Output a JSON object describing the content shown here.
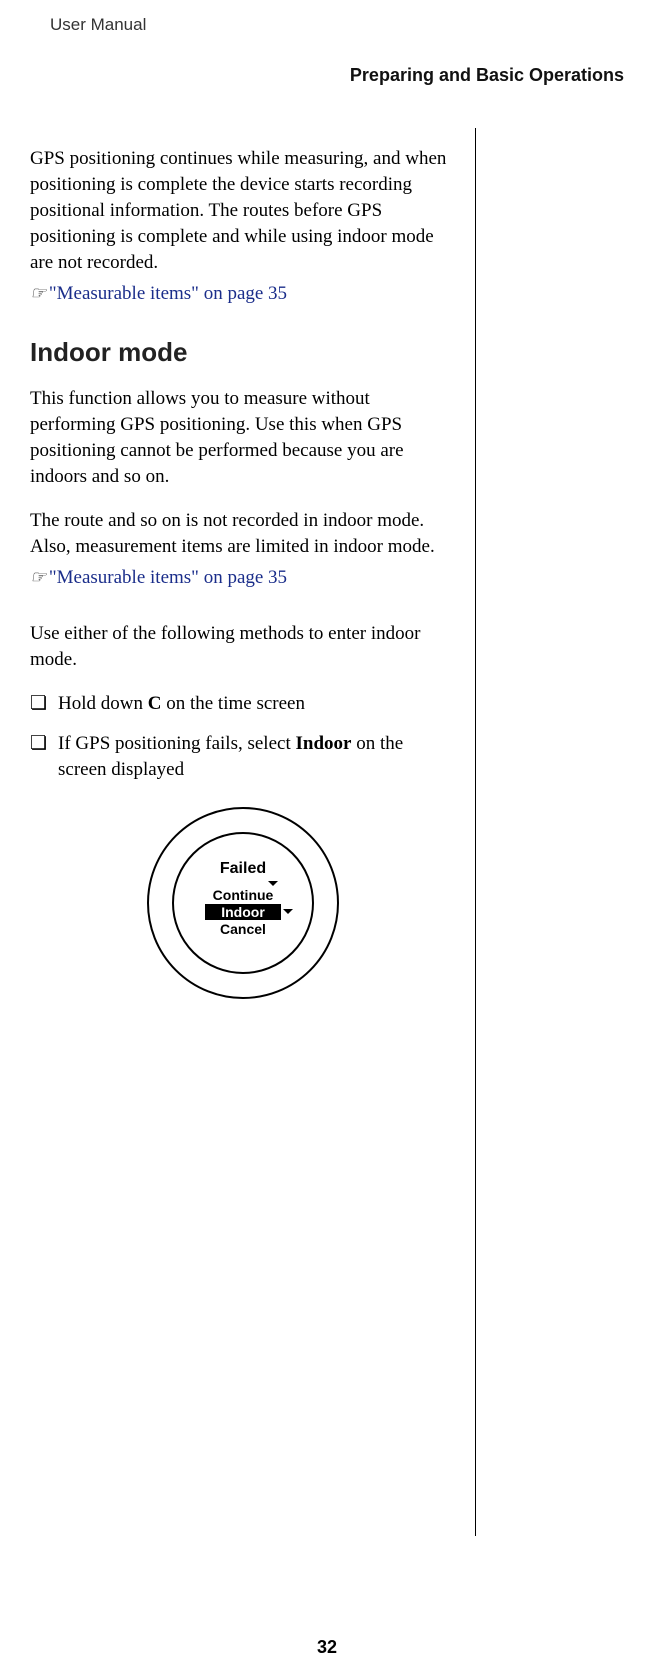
{
  "header": {
    "manual": "User Manual",
    "section": "Preparing and Basic Operations"
  },
  "intro_para": "GPS positioning continues while measuring, and when positioning is complete the device starts recording positional information. The routes before GPS positioning is complete and while using indoor mode are not recorded.",
  "ref1_icon": "☞",
  "ref1_text": "\"Measurable items\" on page 35",
  "h2": "Indoor mode",
  "p1": "This function allows you to measure without performing GPS positioning. Use this when GPS positioning cannot be performed because you are indoors and so on.",
  "p2": "The route and so on is not recorded in indoor mode. Also, measurement items are limited in indoor mode.",
  "ref2_icon": "☞",
  "ref2_text": "\"Measurable items\" on page 35",
  "p3": "Use either of the following methods to enter indoor mode.",
  "bullets": {
    "sym": "❏",
    "b1_pre": "Hold down ",
    "b1_bold": "C",
    "b1_post": " on the time screen",
    "b2_pre": "If GPS positioning fails, select ",
    "b2_bold": "Indoor",
    "b2_post": " on the screen displayed"
  },
  "watch": {
    "title": "Failed",
    "opt1": "Continue",
    "opt2": "Indoor",
    "opt3": "Cancel"
  },
  "page_num": "32"
}
